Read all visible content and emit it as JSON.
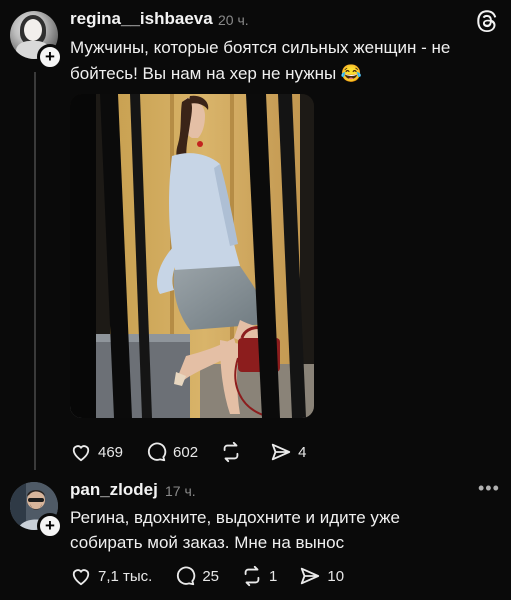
{
  "post1": {
    "username": "regina__ishbaeva",
    "time": "20 ч.",
    "text_line1": "Мужчины, которые боятся сильных женщин - не",
    "text_line2": "бойтесь! Вы нам на хер не нужны 😂",
    "stats": {
      "likes": "469",
      "comments": "602",
      "reposts": "",
      "shares": "4"
    }
  },
  "post2": {
    "username": "pan_zlodej",
    "time": "17 ч.",
    "text_line1": "Регина, вдохните, выдохните и идите уже",
    "text_line2": "собирать мой заказ. Мне на вынос",
    "stats": {
      "likes": "7,1 тыс.",
      "comments": "25",
      "reposts": "1",
      "shares": "10"
    }
  },
  "icons": {
    "app_logo": "threads-logo-icon",
    "like": "heart-icon",
    "comment": "comment-bubble-icon",
    "repost": "repost-icon",
    "share": "send-icon",
    "more": "more-dots-icon",
    "follow": "plus-icon"
  },
  "colors": {
    "background": "#0a0a0a",
    "text": "#f3f3f3",
    "muted": "#8a8a8a",
    "thread_line": "#3a3a3a"
  }
}
